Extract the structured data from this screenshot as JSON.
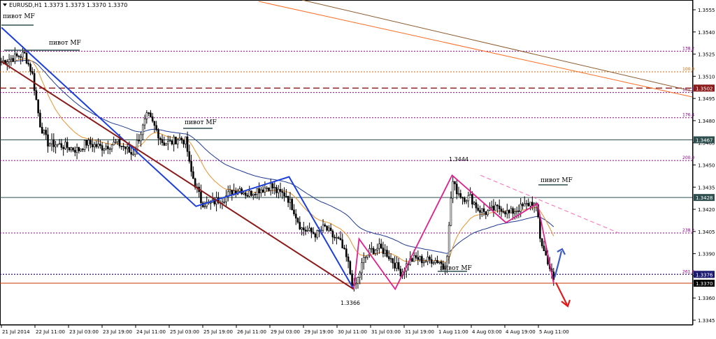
{
  "chart_data": {
    "type": "candlestick",
    "title": "EURUSD,H1  1.3373 1.3373 1.3370 1.3370",
    "symbol": "EURUSD",
    "timeframe": "H1",
    "ohlc_last": {
      "open": 1.3373,
      "high": 1.3373,
      "low": 1.337,
      "close": 1.337
    },
    "ylim": [
      1.334,
      1.356
    ],
    "y_ticks": [
      "1.3555",
      "1.3540",
      "1.3525",
      "1.3510",
      "1.3495",
      "1.3480",
      "1.3465",
      "1.3450",
      "1.3435",
      "1.3420",
      "1.3405",
      "1.3390",
      "1.3375",
      "1.3360",
      "1.3345"
    ],
    "x_ticks": [
      "21 Jul 2014",
      "22 Jul 11:00",
      "23 Jul 03:00",
      "23 Jul 19:00",
      "24 Jul 11:00",
      "25 Jul 03:00",
      "25 Jul 19:00",
      "26 Jul 11:00",
      "29 Jul 03:00",
      "29 Jul 19:00",
      "30 Jul 11:00",
      "31 Jul 03:00",
      "31 Jul 19:00",
      "1 Aug 11:00",
      "4 Aug 03:00",
      "4 Aug 19:00",
      "5 Aug 11:00"
    ],
    "horizontal_levels": [
      {
        "price": 1.3467,
        "tag": "1.3467",
        "style": "solid",
        "color": "#2f4f4f"
      },
      {
        "price": 1.3428,
        "tag": "1.3428",
        "style": "solid",
        "color": "#2f4f4f"
      },
      {
        "price": 1.3502,
        "tag": "1.3502",
        "style": "dashed",
        "color": "#8b1a1a"
      },
      {
        "price": 1.3376,
        "tag": "1.3376",
        "style": "dotted",
        "color": "#191970"
      },
      {
        "price": 1.337,
        "tag": "1.3370",
        "style": "solid",
        "color": "#cd3700"
      }
    ],
    "fib_levels": [
      {
        "label": "138.2",
        "price": 1.3527
      },
      {
        "label": "100.0",
        "price": 1.3513
      },
      {
        "label": "161.8",
        "price": 1.3499
      },
      {
        "label": "176.4",
        "price": 1.3482
      },
      {
        "label": "200.0",
        "price": 1.3453
      },
      {
        "label": "238.2",
        "price": 1.3404
      },
      {
        "label": "261.8",
        "price": 1.3376
      }
    ],
    "pivot_label": "пивот MF",
    "annotations": [
      {
        "text": "1.3444",
        "price": 1.3444,
        "time_index": 61
      },
      {
        "text": "1.3366",
        "price": 1.3366,
        "time_index": 48
      }
    ]
  }
}
